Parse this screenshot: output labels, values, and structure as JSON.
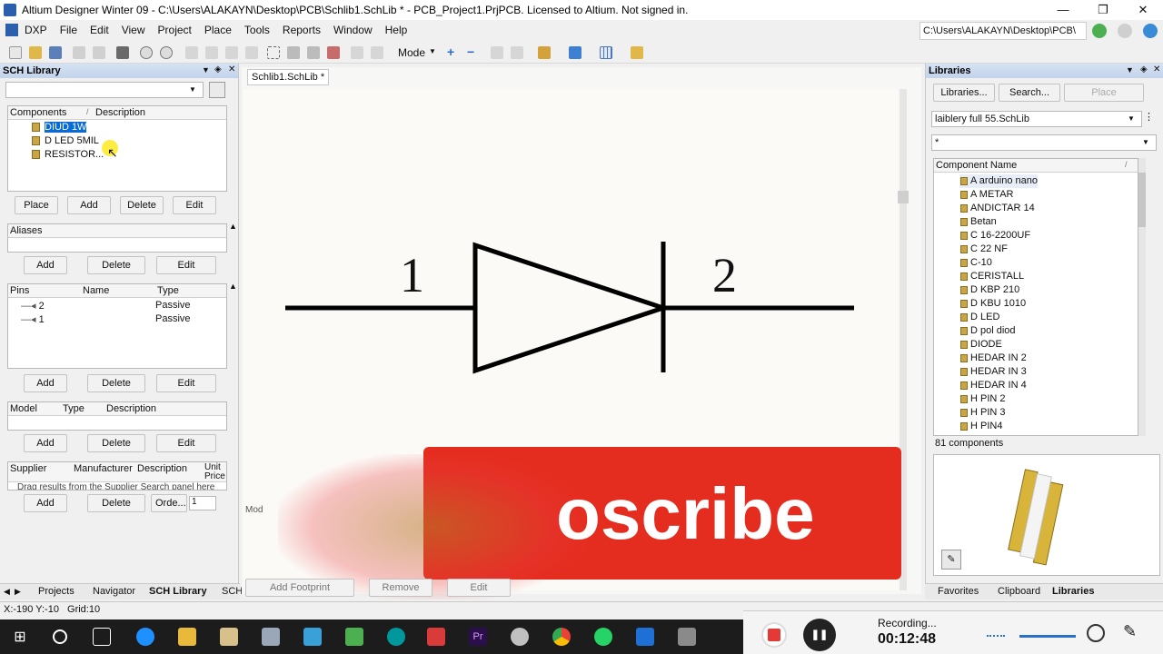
{
  "window": {
    "title": "Altium Designer Winter 09 - C:\\Users\\ALAKAYN\\Desktop\\PCB\\Schlib1.SchLib * - PCB_Project1.PrjPCB. Licensed to Altium. Not signed in.",
    "minimize": "—",
    "restore": "❐",
    "close": "✕"
  },
  "menu": [
    "DXP",
    "File",
    "Edit",
    "View",
    "Project",
    "Place",
    "Tools",
    "Reports",
    "Window",
    "Help"
  ],
  "path_bar": "C:\\Users\\ALAKAYN\\Desktop\\PCB\\",
  "toolbar": {
    "mode_label": "Mode"
  },
  "sch_library": {
    "title": "SCH Library",
    "components_headers": [
      "Components",
      "Description"
    ],
    "components": [
      "DIUD 1W",
      "D LED 5MIL",
      "RESISTOR..."
    ],
    "component_buttons": [
      "Place",
      "Add",
      "Delete",
      "Edit"
    ],
    "aliases_header": "Aliases",
    "alias_buttons": [
      "Add",
      "Delete",
      "Edit"
    ],
    "pins_headers": [
      "Pins",
      "Name",
      "Type"
    ],
    "pins": [
      {
        "pin": "2",
        "type": "Passive"
      },
      {
        "pin": "1",
        "type": "Passive"
      }
    ],
    "pin_buttons": [
      "Add",
      "Delete",
      "Edit"
    ],
    "model_headers": [
      "Model",
      "Type",
      "Description"
    ],
    "model_buttons": [
      "Add",
      "Delete",
      "Edit"
    ],
    "supplier_headers": [
      "Supplier",
      "Manufacturer",
      "Description",
      "Unit Price"
    ],
    "supplier_hint": "Drag results from the Supplier Search panel here",
    "supplier_buttons": [
      "Add",
      "Delete",
      "Orde..."
    ],
    "order_qty": "1"
  },
  "left_tabs": [
    "Projects",
    "Navigator",
    "SCH Library",
    "SCH"
  ],
  "document_tab": "Schlib1.SchLib *",
  "schematic": {
    "pin_left_label": "1",
    "pin_right_label": "2"
  },
  "overlay": {
    "subscribe_text": "oscribe",
    "footprint_buttons": [
      "Add Footprint",
      "Remove",
      "Edit"
    ],
    "mode_short": "Mod"
  },
  "libraries_panel": {
    "title": "Libraries",
    "buttons": [
      "Libraries...",
      "Search...",
      "Place"
    ],
    "library_selected": "laiblery full 55.SchLib",
    "filter": "*",
    "column_header": "Component Name",
    "components": [
      "A arduino nano",
      "A METAR",
      "ANDICTAR 14",
      "Betan",
      "C 16-2200UF",
      "C 22 NF",
      "C-10",
      "CERISTALL",
      "D KBP 210",
      "D KBU 1010",
      "D LED",
      "D pol diod",
      "DIODE",
      "HEDAR IN 2",
      "HEDAR IN 3",
      "HEDAR IN 4",
      "H PIN 2",
      "H PIN 3",
      "H PIN4"
    ],
    "count": "81 components"
  },
  "right_tabs": [
    "Favorites",
    "Clipboard",
    "Libraries"
  ],
  "status": {
    "coords": "X:-190 Y:-10",
    "grid": "Grid:10"
  },
  "recording": {
    "label": "Recording...",
    "time": "00:12:48"
  }
}
